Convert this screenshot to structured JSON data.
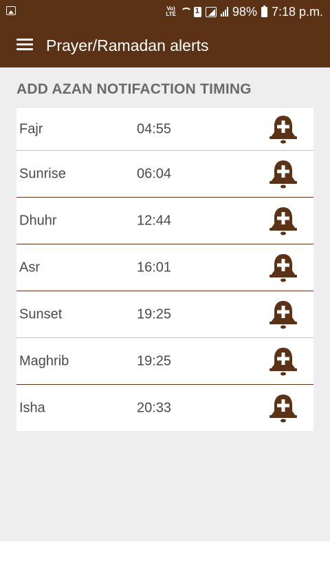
{
  "status_bar": {
    "volte": "Vo)\nLTE",
    "battery_percent": "98%",
    "time": "7:18 p.m."
  },
  "app_bar": {
    "title": "Prayer/Ramadan alerts",
    "menu_icon": "hamburger-menu-icon"
  },
  "section": {
    "header": "ADD AZAN NOTIFACTION TIMING"
  },
  "prayers": [
    {
      "name": "Fajr",
      "time": "04:55",
      "icon": "bell-add-icon"
    },
    {
      "name": "Sunrise",
      "time": "06:04",
      "icon": "bell-add-icon"
    },
    {
      "name": "Dhuhr",
      "time": "12:44",
      "icon": "bell-add-icon"
    },
    {
      "name": "Asr",
      "time": "16:01",
      "icon": "bell-add-icon"
    },
    {
      "name": "Sunset",
      "time": "19:25",
      "icon": "bell-add-icon"
    },
    {
      "name": "Maghrib",
      "time": "19:25",
      "icon": "bell-add-icon"
    },
    {
      "name": "Isha",
      "time": "20:33",
      "icon": "bell-add-icon"
    }
  ],
  "colors": {
    "primary": "#5b3215",
    "background": "#eeeeee",
    "text": "#4a4a4a",
    "header_text": "#6a6a6a"
  }
}
